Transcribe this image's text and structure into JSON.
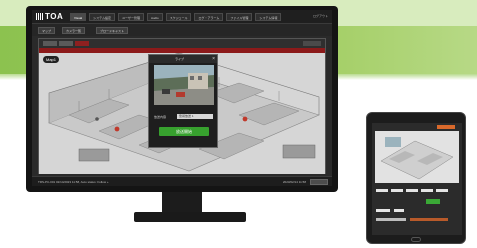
{
  "brand": {
    "name": "TOA"
  },
  "nav": {
    "tabs": [
      {
        "label": "Visual",
        "active": true
      },
      {
        "label": "システム設定",
        "active": false
      },
      {
        "label": "ユーザー管理",
        "active": false
      },
      {
        "label": "Audio",
        "active": false
      },
      {
        "label": "スケジュール",
        "active": false
      },
      {
        "label": "ログ・アラーム",
        "active": false
      },
      {
        "label": "ファイル管理",
        "active": false
      },
      {
        "label": "システム情報",
        "active": false
      }
    ],
    "status": "ログアウト"
  },
  "toolbar": {
    "buttons": [
      "マップ",
      "カメラ一覧",
      "ブロードキャスト"
    ]
  },
  "floor": {
    "badge": "Map1"
  },
  "modal": {
    "title": "ライブ",
    "close": "×",
    "field_label": "放送内容",
    "field_value": "警報放送 1",
    "action_label": "放送開始"
  },
  "statusbar": {
    "text": "TRS-PC-001 02/14/2023 11:58, Auto status: Follow +",
    "right": "2023/02/14 11:58"
  },
  "colors": {
    "banner_green": "#8cc24f",
    "alert_red": "#8c1a1a",
    "action_green": "#37a12e",
    "tablet_accent": "#d9692b"
  }
}
